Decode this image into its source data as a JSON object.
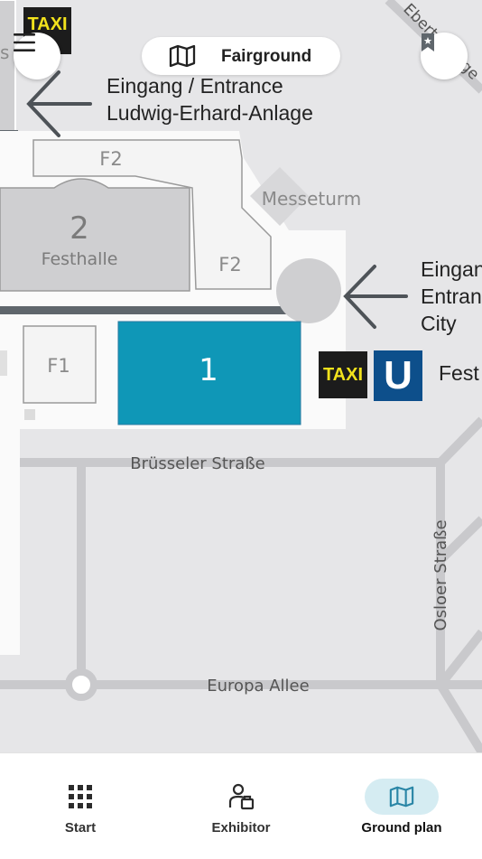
{
  "header": {
    "title": "Fairground",
    "title_icon": "map-icon",
    "menu_icon": "hamburger-menu-icon",
    "bookmark_icon": "bookmark-icon"
  },
  "map": {
    "colors": {
      "hall_highlight": "#0f97b7",
      "background": "#e6e6e8",
      "roads": "#c9c9cc",
      "buildings": "#cfcfd1"
    },
    "badges": {
      "taxi": "TAXI",
      "ubahn": "U"
    },
    "entrances": {
      "ludwig_line1": "Eingang / Entrance",
      "ludwig_line2": "Ludwig-Erhard-Anlage",
      "city_line1": "Eingang",
      "city_line2": "Entrance",
      "city_line3": "City"
    },
    "fest_label": "Fest",
    "buildings": {
      "hall_1": "1",
      "hall_2": "2",
      "festhalle": "Festhalle",
      "f1": "F1",
      "f2_top": "F2",
      "f2_bottom": "F2",
      "messeturm": "Messeturm",
      "left_partial": "s"
    },
    "streets": {
      "bruesseler": "Brüsseler Straße",
      "europa": "Europa Allee",
      "osloer": "Osloer Straße",
      "ebert": "Ebert-Anlage"
    }
  },
  "bottom_nav": {
    "items": [
      {
        "label": "Start",
        "icon": "grid-icon",
        "active": false
      },
      {
        "label": "Exhibitor",
        "icon": "exhibitor-icon",
        "active": false
      },
      {
        "label": "Ground plan",
        "icon": "map-icon",
        "active": true
      }
    ]
  }
}
